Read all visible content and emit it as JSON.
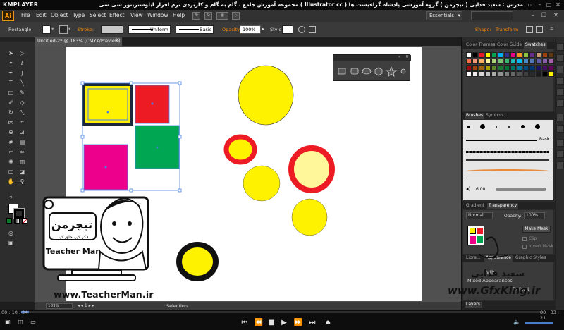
{
  "player": {
    "logo": "KMPLAYER",
    "title": "مجموعه آموزش جامع ، گام به گام و کاربردی نرم افزار ایلوستریتور سی سی ( Illustrator cc )   مدرس : سعید فدایی ( تیچرمن ) گروه آموزشی پادشاه گرافیست ها",
    "time_elapsed": "00 : 10 : 24",
    "time_total": "00 : 33 : 21",
    "progress_fraction": 0.015
  },
  "menubar": {
    "logo": "Ai",
    "items": [
      "File",
      "Edit",
      "Object",
      "Type",
      "Select",
      "Effect",
      "View",
      "Window",
      "Help"
    ],
    "workspace": "Essentials"
  },
  "controlbar": {
    "selection_type": "Rectangle",
    "stroke_label": "Stroke:",
    "profile": "Uniform",
    "brush": "Basic",
    "opacity_label": "Opacity:",
    "opacity_value": "100%",
    "style_label": "Style:",
    "shape_label": "Shape:",
    "transform_label": "Transform"
  },
  "document": {
    "tab_title": "Untitled-2* @ 183% (CMYK/Preview)",
    "zoom": "183%",
    "status": "Selection"
  },
  "shape_palette": {
    "icons": [
      "rectangle-icon",
      "rounded-rectangle-icon",
      "ellipse-icon",
      "polygon-icon",
      "star-icon",
      "flare-icon"
    ]
  },
  "panels": {
    "color_tabs": [
      "Color Themes",
      "Color Guide",
      "Swatches"
    ],
    "brush_tabs": [
      "Brushes",
      "Symbols"
    ],
    "brush_basic": "Basic",
    "brush_size": "6.00",
    "transparency_tabs": [
      "Gradient",
      "Transparency"
    ],
    "blend_mode": "Normal",
    "opacity_label": "Opacity:",
    "opacity_value": "100%",
    "make_mask": "Make Mask",
    "clip": "Clip",
    "invert_mask": "Invert Mask",
    "appearance_tabs": [
      "Libra...",
      "Appearance",
      "Graphic Styles"
    ],
    "appearance_path": "Path",
    "appearance_mixed": "Mixed Appearances",
    "appearance_default": "Default",
    "layers_tab": "Layers"
  },
  "overlays": {
    "teacher_logo_fa": "تیچرمن",
    "teacher_sub_fa": "فکر کن، خلق کن",
    "teacher_name": "Teacher Man",
    "teacher_site": "www.TeacherMan.ir",
    "signature_fa": "سعید فدایی",
    "gfxking": "www.GfxKing.ir"
  },
  "colors": {
    "yellow": "#fff200",
    "red": "#ed1c24",
    "green": "#00a651",
    "magenta": "#ec008c",
    "pale_yellow": "#fff799",
    "selection": "#4a7fe0",
    "ai_orange": "#ff9a00"
  }
}
